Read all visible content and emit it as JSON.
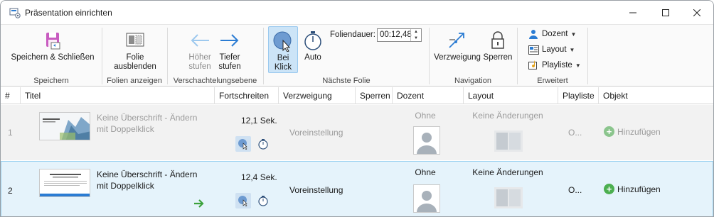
{
  "window": {
    "title": "Präsentation einrichten"
  },
  "ribbon": {
    "groups": {
      "save": {
        "label": "Speichern",
        "button": "Speichern & Schließen"
      },
      "show": {
        "label": "Folien anzeigen",
        "button": "Folie ausblenden"
      },
      "nesting": {
        "label": "Verschachtelungsebene",
        "up": "Höher stufen",
        "down": "Tiefer stufen"
      },
      "next": {
        "label": "Nächste Folie",
        "on_click": "Bei Klick",
        "auto": "Auto",
        "duration_label": "Foliendauer:",
        "duration_value": "00:12,48"
      },
      "navigation": {
        "label": "Navigation",
        "branch": "Verzweigung",
        "lock": "Sperren"
      },
      "advanced": {
        "label": "Erweitert",
        "presenter": "Dozent",
        "layout": "Layout",
        "playlist": "Playliste"
      }
    }
  },
  "table": {
    "headers": [
      "#",
      "Titel",
      "Fortschreiten",
      "Verzweigung",
      "Sperren",
      "Dozent",
      "Layout",
      "Playliste",
      "Objekt"
    ],
    "rows": [
      {
        "num": "1",
        "title": "Keine Überschrift - Ändern mit Doppelklick",
        "advance": "12,1 Sek.",
        "branch": "Voreinstellung",
        "presenter": "Ohne",
        "layout": "Keine Änderungen",
        "playlist": "O...",
        "object": "Hinzufügen"
      },
      {
        "num": "2",
        "title": "Keine Überschrift - Ändern mit Doppelklick",
        "advance": "12,4 Sek.",
        "branch": "Voreinstellung",
        "presenter": "Ohne",
        "layout": "Keine Änderungen",
        "playlist": "O...",
        "object": "Hinzufügen"
      }
    ]
  },
  "colors": {
    "accent": "#2b7cd3",
    "selection": "#e5f3fb",
    "add_green": "#4caf50"
  }
}
